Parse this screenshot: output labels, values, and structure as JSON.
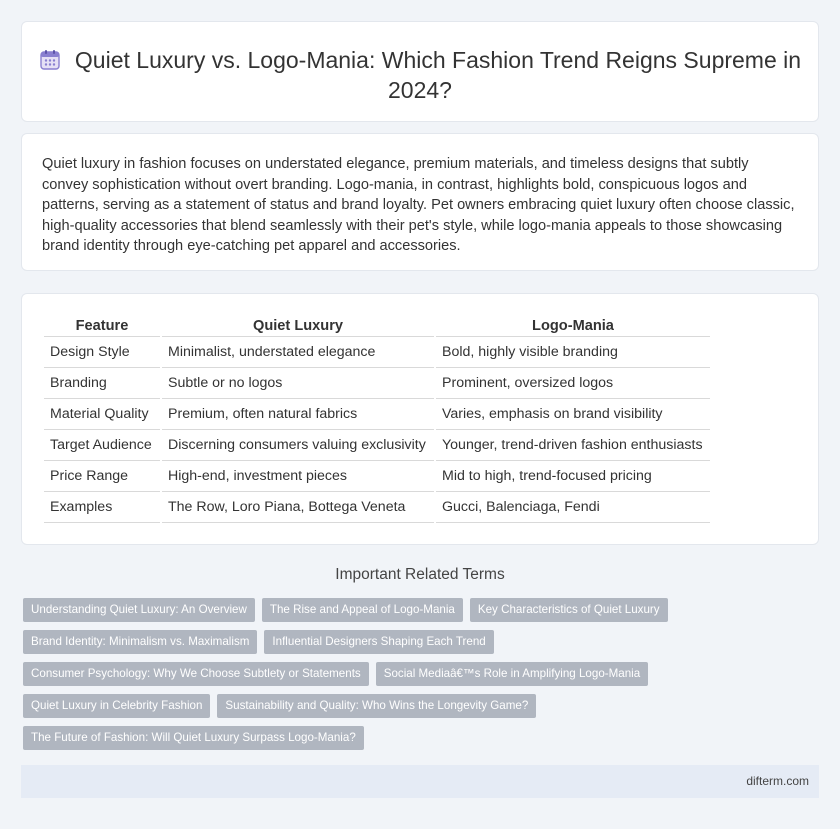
{
  "header": {
    "icon": "calendar-icon",
    "title": "Quiet Luxury vs. Logo-Mania: Which Fashion Trend Reigns Supreme in 2024?"
  },
  "intro": {
    "text": "Quiet luxury in fashion focuses on understated elegance, premium materials, and timeless designs that subtly convey sophistication without overt branding. Logo-mania, in contrast, highlights bold, conspicuous logos and patterns, serving as a statement of status and brand loyalty. Pet owners embracing quiet luxury often choose classic, high-quality accessories that blend seamlessly with their pet's style, while logo-mania appeals to those showcasing brand identity through eye-catching pet apparel and accessories."
  },
  "table": {
    "headers": [
      "Feature",
      "Quiet Luxury",
      "Logo-Mania"
    ],
    "rows": [
      [
        "Design Style",
        "Minimalist, understated elegance",
        "Bold, highly visible branding"
      ],
      [
        "Branding",
        "Subtle or no logos",
        "Prominent, oversized logos"
      ],
      [
        "Material Quality",
        "Premium, often natural fabrics",
        "Varies, emphasis on brand visibility"
      ],
      [
        "Target Audience",
        "Discerning consumers valuing exclusivity",
        "Younger, trend-driven fashion enthusiasts"
      ],
      [
        "Price Range",
        "High-end, investment pieces",
        "Mid to high, trend-focused pricing"
      ],
      [
        "Examples",
        "The Row, Loro Piana, Bottega Veneta",
        "Gucci, Balenciaga, Fendi"
      ]
    ]
  },
  "related": {
    "title": "Important Related Terms",
    "tags": [
      [
        "Understanding Quiet Luxury: An Overview",
        "The Rise and Appeal of Logo-Mania",
        "Key Characteristics of Quiet Luxury"
      ],
      [
        "Brand Identity: Minimalism vs. Maximalism",
        "Influential Designers Shaping Each Trend"
      ],
      [
        "Consumer Psychology: Why We Choose Subtlety or Statements",
        "Social Mediaâ€™s Role in Amplifying Logo-Mania"
      ],
      [
        "Quiet Luxury in Celebrity Fashion",
        "Sustainability and Quality: Who Wins the Longevity Game?"
      ],
      [
        "The Future of Fashion: Will Quiet Luxury Surpass Logo-Mania?"
      ]
    ]
  },
  "footer": {
    "text": "difterm.com"
  }
}
